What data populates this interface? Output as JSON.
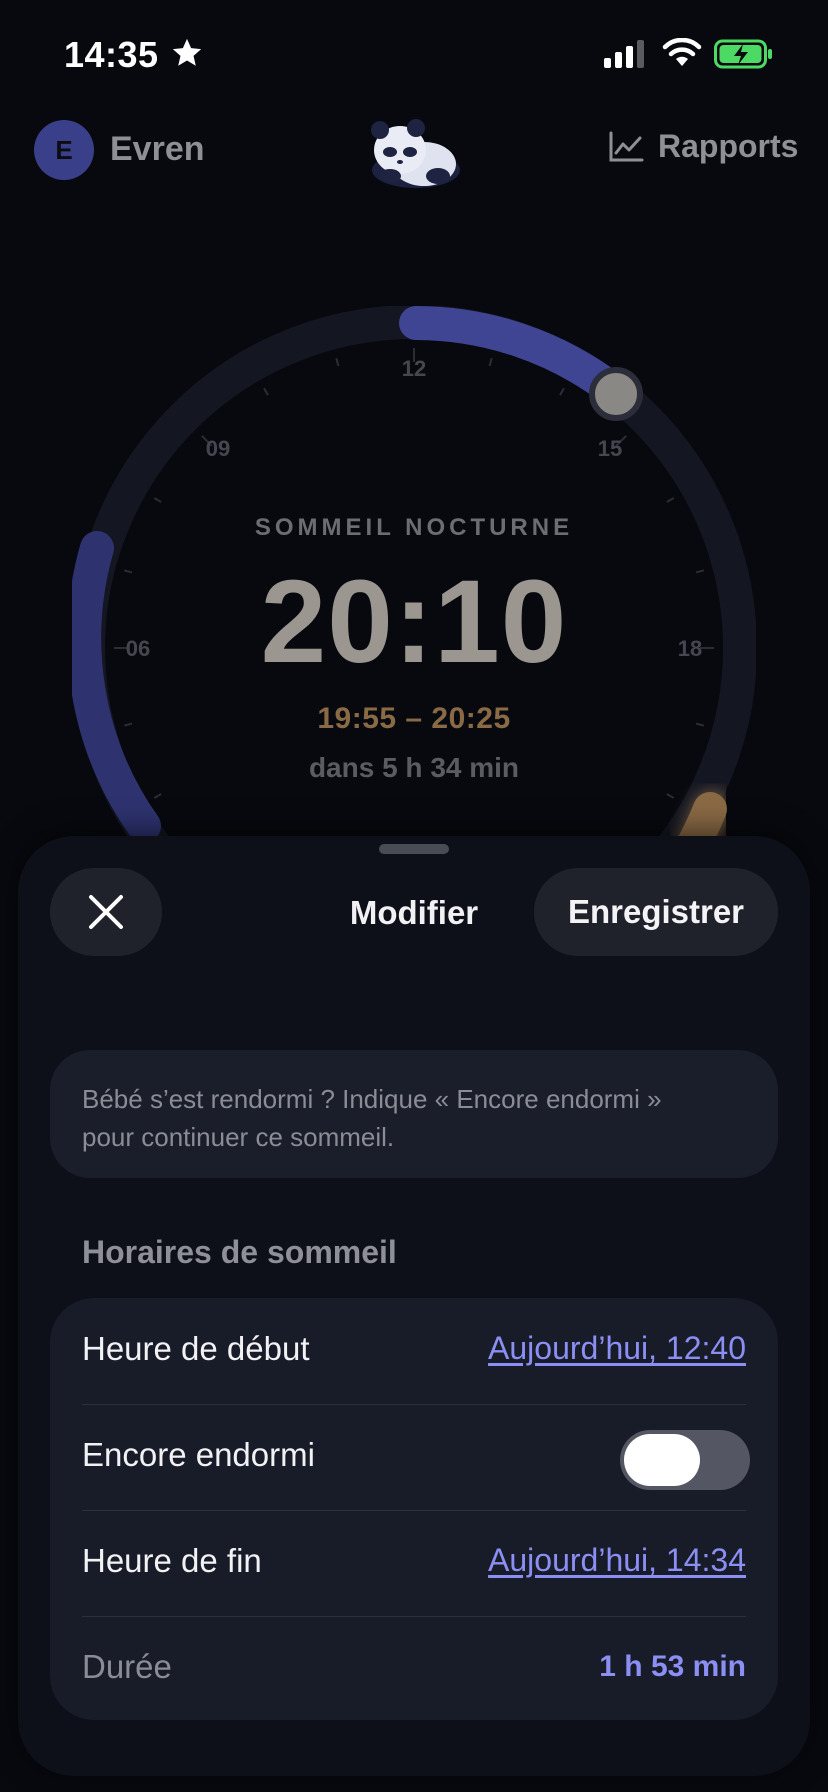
{
  "status_bar": {
    "time": "14:35"
  },
  "header": {
    "avatar_initial": "E",
    "profile_name": "Evren",
    "reports_label": "Rapports"
  },
  "dial": {
    "hour_labels": [
      "12",
      "15",
      "18",
      "06",
      "09"
    ],
    "sleep_type": "SOMMEIL NOCTURNE",
    "predicted_time": "20:10",
    "predicted_window": "19:55 – 20:25",
    "countdown": "dans 5 h 34 min"
  },
  "sheet": {
    "title": "Modifier",
    "save_label": "Enregistrer",
    "info_text_line1": "Bébé s’est rendormi ? Indique « Encore endormi »",
    "info_text_line2": "pour continuer ce sommeil.",
    "section_title": "Horaires de sommeil",
    "rows": {
      "start_label": "Heure de début",
      "start_value": "Aujourd’hui, 12:40",
      "still_asleep_label": "Encore endormi",
      "still_asleep_on": false,
      "end_label": "Heure de fin",
      "end_value": "Aujourd’hui, 14:34",
      "duration_label": "Durée",
      "duration_value": "1 h 53 min"
    }
  },
  "colors": {
    "accent": "#8b8ff4",
    "arc": "#3f4593",
    "window": "#8a6a45",
    "sheet": "#0d1019"
  }
}
